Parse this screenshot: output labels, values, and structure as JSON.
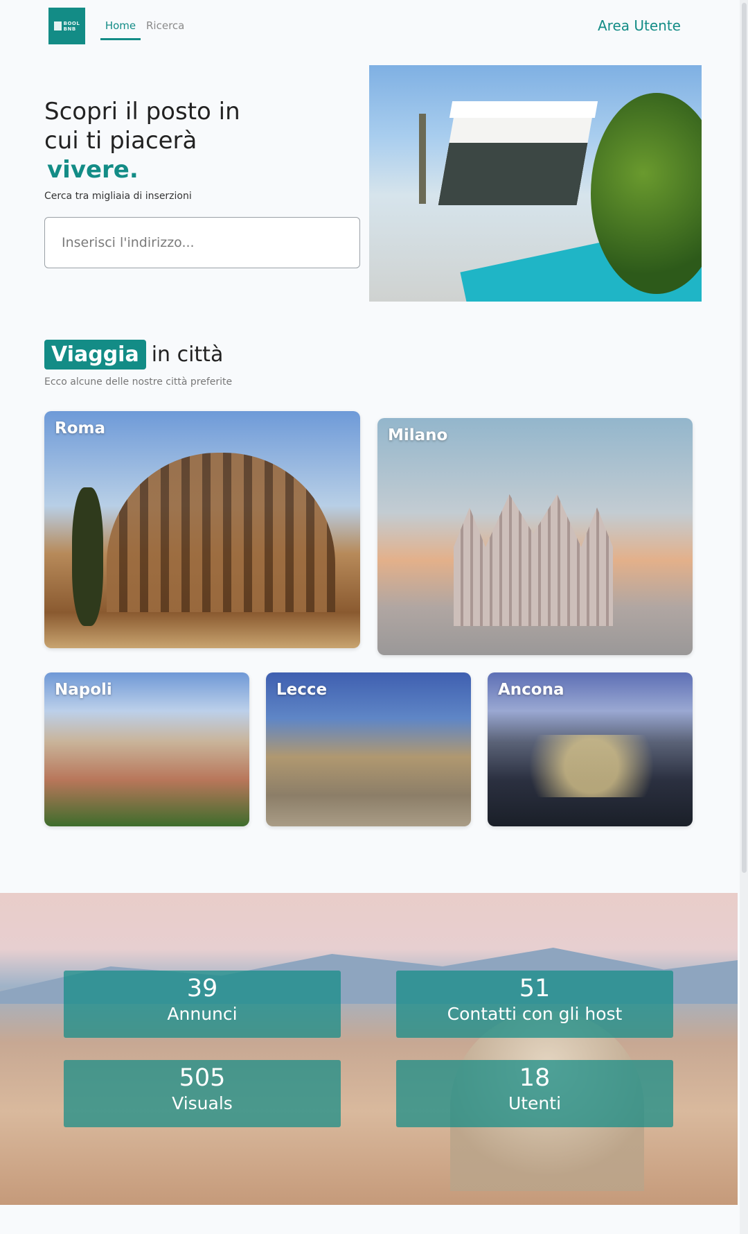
{
  "header": {
    "logo_lines": [
      "BOOL",
      "BNB"
    ],
    "nav": [
      {
        "label": "Home",
        "active": true
      },
      {
        "label": "Ricerca",
        "active": false
      }
    ],
    "user_area_label": "Area Utente"
  },
  "hero": {
    "title_line1": "Scopri il posto in",
    "title_line2": "cui ti piacerà",
    "title_accent": "vivere.",
    "subtitle": "Cerca tra migliaia di inserzioni",
    "search_placeholder": "Inserisci l'indirizzo..."
  },
  "cities_section": {
    "title_badge": "Viaggia",
    "title_rest": "in città",
    "subtitle": "Ecco alcune delle nostre città preferite",
    "cities": [
      {
        "name": "Roma"
      },
      {
        "name": "Milano"
      },
      {
        "name": "Napoli"
      },
      {
        "name": "Lecce"
      },
      {
        "name": "Ancona"
      }
    ]
  },
  "stats": [
    {
      "value": "39",
      "label": "Annunci"
    },
    {
      "value": "51",
      "label": "Contatti con gli host"
    },
    {
      "value": "505",
      "label": "Visuals"
    },
    {
      "value": "18",
      "label": "Utenti"
    }
  ],
  "colors": {
    "accent": "#138c86",
    "background": "#f8fafc"
  }
}
